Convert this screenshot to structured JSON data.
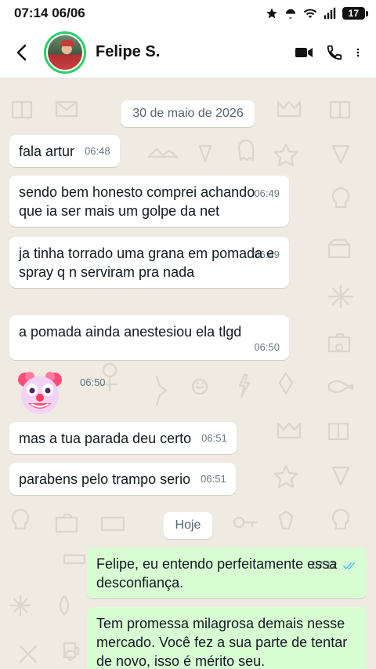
{
  "status_bar": {
    "time_date": "07:14 06/06",
    "battery": "17"
  },
  "header": {
    "contact_name": "Felipe S."
  },
  "chat": {
    "date_separator_1": "30 de maio de 2026",
    "date_separator_2": "Hoje",
    "messages": [
      {
        "text": "fala artur",
        "time": "06:48"
      },
      {
        "text": "sendo bem honesto comprei achando que ia ser mais um golpe da net",
        "time": "06:49"
      },
      {
        "text": "ja tinha torrado uma grana em pomada e spray q n serviram pra nada",
        "time": "06:49"
      },
      {
        "text": "a pomada ainda anestesiou ela tlgd",
        "time": "06:50"
      },
      {
        "text": "",
        "time": "06:50"
      },
      {
        "text": "mas a tua parada deu certo",
        "time": "06:51"
      },
      {
        "text": "parabens pelo trampo serio",
        "time": "06:51"
      },
      {
        "text": "Felipe, eu entendo perfeitamente essa desconfiança.",
        "time": "07:12"
      },
      {
        "text": "Tem promessa milagrosa demais nesse mercado. Você fez a sua parte de tentar de novo, isso é mérito seu.",
        "time": ""
      }
    ]
  },
  "colors": {
    "chat_background": "#efeae2",
    "outgoing_bubble": "#d9fdd3",
    "incoming_bubble": "#ffffff",
    "online_ring": "#25d366",
    "read_ticks": "#53bdeb"
  },
  "icons": [
    "star-icon",
    "alarm-icon",
    "wifi-icon",
    "signal-icon",
    "battery-icon",
    "back-arrow-icon",
    "video-call-icon",
    "phone-icon",
    "more-vert-icon",
    "clown-sticker",
    "double-check-icon"
  ]
}
